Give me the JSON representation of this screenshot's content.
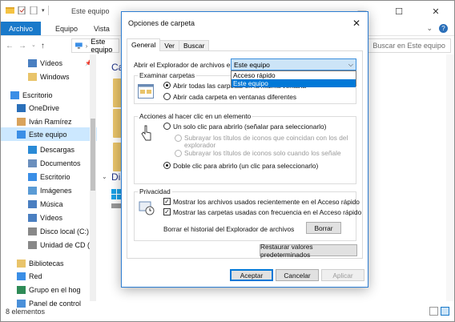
{
  "explorer": {
    "title": "Este equipo",
    "ribbon_tabs": [
      "Archivo",
      "Equipo",
      "Vista"
    ],
    "address_text": "Este equipo",
    "search_placeholder": "Buscar en Este equipo",
    "nav_items": [
      {
        "label": "Vídeos",
        "icon": "video-folder-icon",
        "pinned": true
      },
      {
        "label": "Windows",
        "icon": "folder-icon",
        "pinned": false
      },
      {
        "label": "Escritorio",
        "icon": "desktop-icon",
        "pinned": false
      },
      {
        "label": "OneDrive",
        "icon": "onedrive-icon",
        "pinned": false
      },
      {
        "label": "Iván Ramírez",
        "icon": "user-icon",
        "pinned": false
      },
      {
        "label": "Este equipo",
        "icon": "computer-icon",
        "pinned": false,
        "selected": true
      },
      {
        "label": "Descargas",
        "icon": "downloads-icon",
        "pinned": false
      },
      {
        "label": "Documentos",
        "icon": "documents-icon",
        "pinned": false
      },
      {
        "label": "Escritorio",
        "icon": "desktop-icon",
        "pinned": false
      },
      {
        "label": "Imágenes",
        "icon": "pictures-icon",
        "pinned": false
      },
      {
        "label": "Música",
        "icon": "music-icon",
        "pinned": false
      },
      {
        "label": "Vídeos",
        "icon": "video-folder-icon",
        "pinned": false
      },
      {
        "label": "Disco local (C:)",
        "icon": "drive-icon",
        "pinned": false
      },
      {
        "label": "Unidad de CD (",
        "icon": "cd-drive-icon",
        "pinned": false
      },
      {
        "label": "Bibliotecas",
        "icon": "library-icon",
        "pinned": false
      },
      {
        "label": "Red",
        "icon": "network-icon",
        "pinned": false
      },
      {
        "label": "Grupo en el hog",
        "icon": "homegroup-icon",
        "pinned": false
      },
      {
        "label": "Panel de control",
        "icon": "control-panel-icon",
        "pinned": false
      }
    ],
    "content_headers": {
      "first": "Ca",
      "second": "Dis"
    },
    "status_text": "8 elementos",
    "accent_color": "#1979ca"
  },
  "dialog": {
    "title": "Opciones de carpeta",
    "tabs": [
      "General",
      "Ver",
      "Buscar"
    ],
    "active_tab": "General",
    "open_explorer_label": "Abrir el Explorador de archivos en:",
    "open_explorer_value": "Este equipo",
    "open_explorer_options": [
      "Acceso rápido",
      "Este equipo"
    ],
    "highlighted_option": "Este equipo",
    "browse_group": {
      "title": "Examinar carpetas",
      "opt_same_window": "Abrir todas las carpetas en la misma ventana",
      "opt_new_window": "Abrir cada carpeta en ventanas diferentes",
      "selected": "same_window"
    },
    "click_group": {
      "title": "Acciones al hacer clic en un elemento",
      "opt_single": "Un solo clic para abrirlo (señalar para seleccionarlo)",
      "sub_browser_line1": "Subrayar los títulos de iconos que coincidan con los del",
      "sub_browser_line2": "explorador",
      "sub_point": "Subrayar los títulos de iconos solo cuando los señale",
      "opt_double": "Doble clic para abrirlo (un clic para seleccionarlo)",
      "selected": "double"
    },
    "privacy_group": {
      "title": "Privacidad",
      "check_recent_files": "Mostrar los archivos usados recientemente en el Acceso rápido",
      "check_frequent_folders": "Mostrar las carpetas usadas con frecuencia en el Acceso rápido",
      "recent_checked": true,
      "frequent_checked": true,
      "clear_label": "Borrar el historial del Explorador de archivos",
      "clear_button": "Borrar"
    },
    "restore_button": "Restaurar valores predeterminados",
    "ok_button": "Aceptar",
    "cancel_button": "Cancelar",
    "apply_button": "Aplicar"
  }
}
